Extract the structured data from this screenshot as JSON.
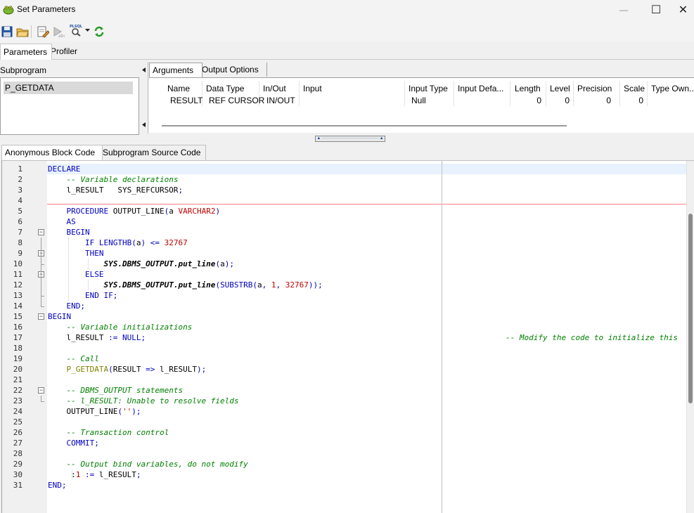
{
  "window": {
    "title": "Set Parameters",
    "minimize": "—",
    "maximize": "☐",
    "close": "✕"
  },
  "top_tabs": [
    "Parameters",
    "Profiler"
  ],
  "subprogram": {
    "header": "Subprogram",
    "items": [
      "P_GETDATA"
    ]
  },
  "arg_tabs": [
    "Arguments",
    "Output Options"
  ],
  "grid": {
    "columns": [
      "Name",
      "Data Type",
      "In/Out",
      "Input",
      "Input Type",
      "Input Defa...",
      "Length",
      "Level",
      "Precision",
      "Scale",
      "Type Own..."
    ],
    "rows": [
      {
        "name": "RESULT",
        "data_type": "REF CURSOR",
        "in_out": "IN/OUT",
        "input": "",
        "input_type": "Null",
        "input_default": "",
        "length": "0",
        "level": "0",
        "precision": "0",
        "scale": "0",
        "type_owner": ""
      }
    ]
  },
  "bottom_tabs": [
    "Anonymous Block Code",
    "Subprogram Source Code"
  ],
  "code_lines": [
    "DECLARE",
    "    -- Variable declarations",
    "    l_RESULT   SYS_REFCURSOR;",
    "",
    "    PROCEDURE OUTPUT_LINE(a VARCHAR2)",
    "    AS",
    "    BEGIN",
    "        IF LENGTHB(a) <= 32767",
    "        THEN",
    "            SYS.DBMS_OUTPUT.put_line(a);",
    "        ELSE",
    "            SYS.DBMS_OUTPUT.put_line(SUBSTRB(a, 1, 32767));",
    "        END IF;",
    "    END;",
    "BEGIN",
    "    -- Variable initializations",
    "    l_RESULT := NULL;",
    "",
    "    -- Call",
    "    P_GETDATA(RESULT => l_RESULT);",
    "",
    "    -- DBMS_OUTPUT statements",
    "    -- l_RESULT: Unable to resolve fields",
    "    OUTPUT_LINE('');",
    "",
    "    -- Transaction control",
    "    COMMIT;",
    "",
    "    -- Output bind variables, do not modify",
    "     :1 := l_RESULT;",
    "END;"
  ],
  "right_comment": "-- Modify the code to initialize this",
  "toolbar_icons": [
    "save-icon",
    "open-folder-icon",
    "edit-icon",
    "debug-icon",
    "dbms-output-icon",
    "dropdown-arrow-icon",
    "refresh-icon"
  ]
}
